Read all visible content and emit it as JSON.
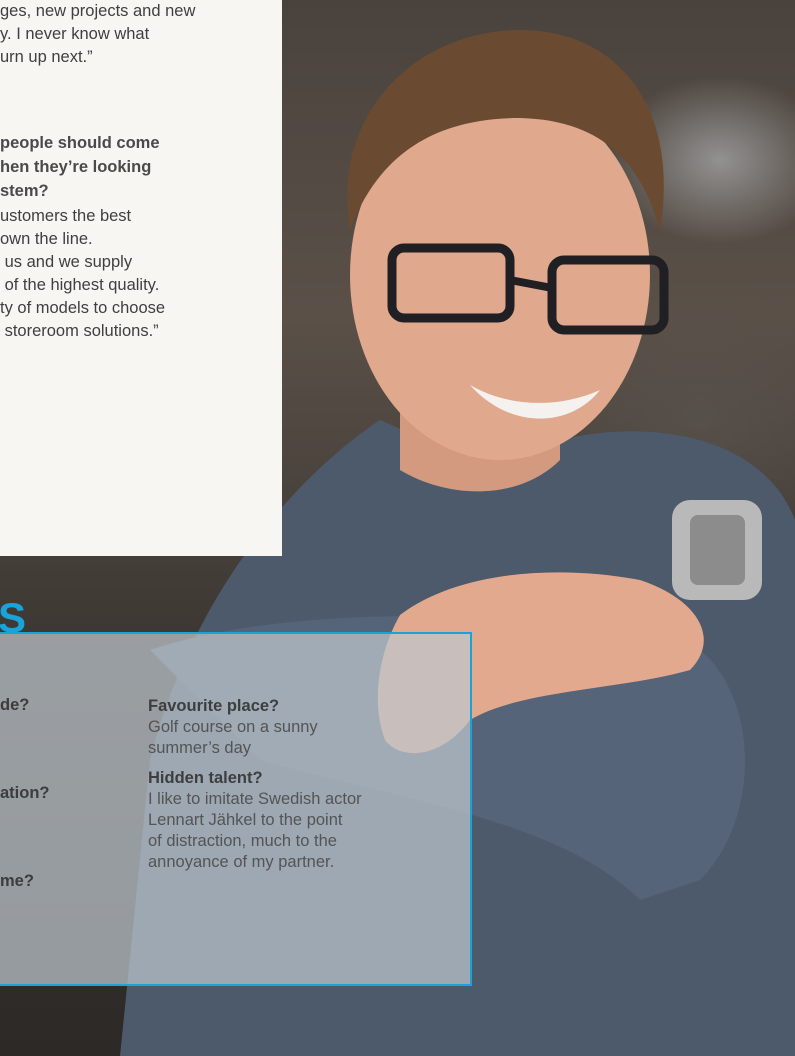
{
  "article": {
    "quote_end": "ges, new projects and new\ny. I never know what\nurn up next.”",
    "question": "people should come\nhen they’re looking\nstem?",
    "answer": "ustomers the best\nown the line.\n us and we supply\n of the highest quality.\nty of models to choose\n storeroom solutions.”"
  },
  "facts": {
    "heading": "S",
    "left_questions": [
      "de?",
      "ation?",
      "me?"
    ],
    "right_items": [
      {
        "question": "Favourite place?",
        "answer": "Golf course on a sunny\nsummer’s day"
      },
      {
        "question": "Hidden talent?",
        "answer": "I like to imitate Swedish actor\nLennart Jähkel to the point\nof distraction, much to the\nannoyance of my partner."
      }
    ]
  },
  "colors": {
    "accent": "#1aa3d8",
    "panel": "#f8f6f2",
    "text": "#3c3c3c"
  }
}
